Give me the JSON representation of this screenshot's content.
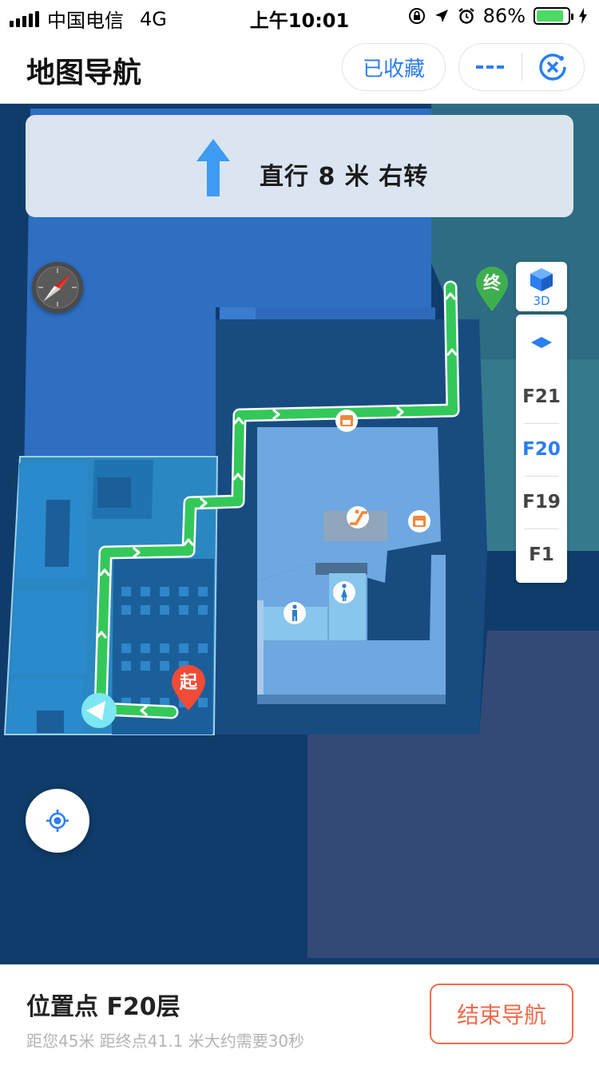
{
  "status_bar": {
    "carrier": "中国电信",
    "network": "4G",
    "time": "上午10:01",
    "battery": "86%",
    "battery_level": 0.86
  },
  "header": {
    "title": "地图导航",
    "favorite_label": "已收藏",
    "icons": [
      "more-icon",
      "close-icon"
    ]
  },
  "navigation": {
    "instruction": "直行 8 米 右转",
    "direction_icon": "arrow-up-icon"
  },
  "map": {
    "start_marker": "起",
    "end_marker": "终",
    "view_mode": "3D",
    "floors": [
      "F21",
      "F20",
      "F19",
      "F1"
    ],
    "active_floor": "F20",
    "colors": {
      "route": "#34c759",
      "start_marker": "#f04b37",
      "end_marker": "#3fae4e",
      "accent": "#2b7ef0"
    },
    "icons": [
      "compass-icon",
      "cube-3d-icon",
      "floor-toggle-icon",
      "locate-icon",
      "elevator-icon",
      "escalator-icon",
      "restroom-male-icon",
      "restroom-female-icon"
    ]
  },
  "bottom": {
    "location": "位置点 F20层",
    "summary": "距您45米  距终点41.1 米大约需要30秒",
    "end_label": "结束导航"
  }
}
